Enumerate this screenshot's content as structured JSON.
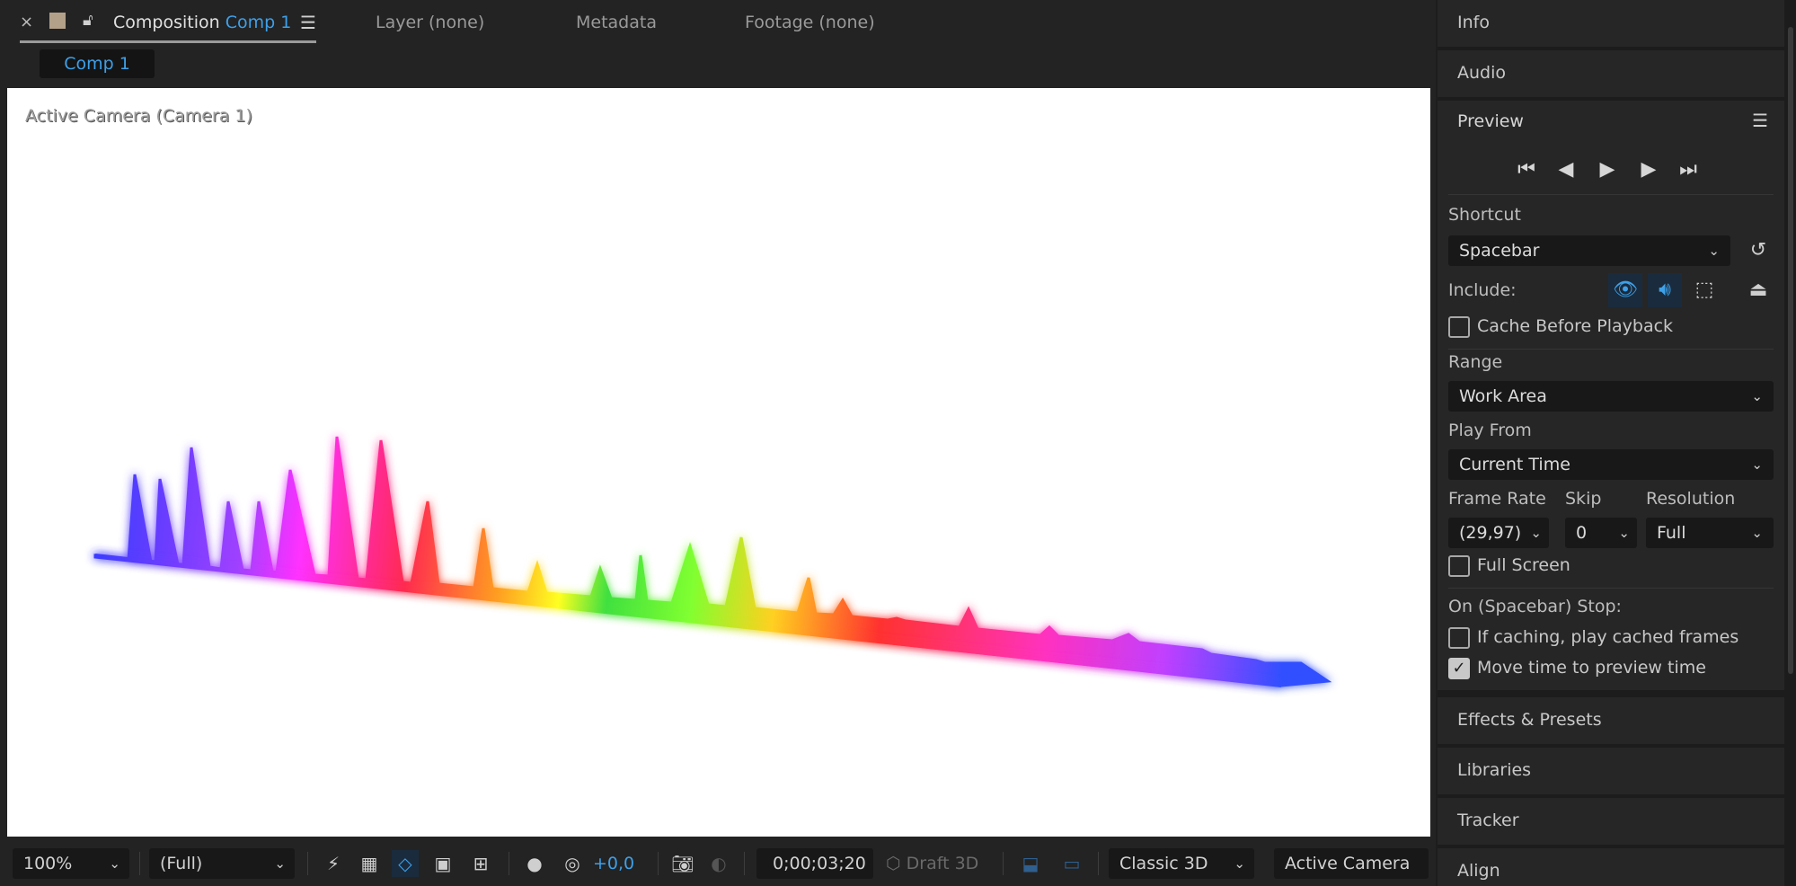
{
  "tabs": {
    "close": "×",
    "composition_label": "Composition",
    "composition_name": "Comp 1",
    "layer": "Layer (none)",
    "metadata": "Metadata",
    "footage": "Footage (none)"
  },
  "subtab": "Comp 1",
  "viewport": {
    "camera_label": "Active Camera (Camera 1)"
  },
  "toolbar": {
    "zoom": "100%",
    "resolution": "(Full)",
    "exposure": "+0,0",
    "timecode": "0;00;03;20",
    "draft3d": "Draft 3D",
    "renderer": "Classic 3D",
    "camera_view": "Active Camera ..."
  },
  "right_panels": {
    "info": "Info",
    "audio": "Audio",
    "effects": "Effects & Presets",
    "libraries": "Libraries",
    "tracker": "Tracker",
    "align": "Align"
  },
  "preview": {
    "title": "Preview",
    "shortcut_label": "Shortcut",
    "shortcut_value": "Spacebar",
    "include_label": "Include:",
    "cache_before_playback": "Cache Before Playback",
    "cache_before_playback_checked": false,
    "range_label": "Range",
    "range_value": "Work Area",
    "play_from_label": "Play From",
    "play_from_value": "Current Time",
    "frame_rate_label": "Frame Rate",
    "frame_rate_value": "(29,97)",
    "skip_label": "Skip",
    "skip_value": "0",
    "resolution_label": "Resolution",
    "resolution_value": "Full",
    "full_screen": "Full Screen",
    "full_screen_checked": false,
    "stop_label": "On (Spacebar) Stop:",
    "if_caching": "If caching, play cached frames",
    "if_caching_checked": false,
    "move_time": "Move time to preview time",
    "move_time_checked": true
  },
  "colors": {
    "accent": "#3ea0e8",
    "viewport_bg": "#ffffff",
    "panel_bg": "#262626"
  }
}
